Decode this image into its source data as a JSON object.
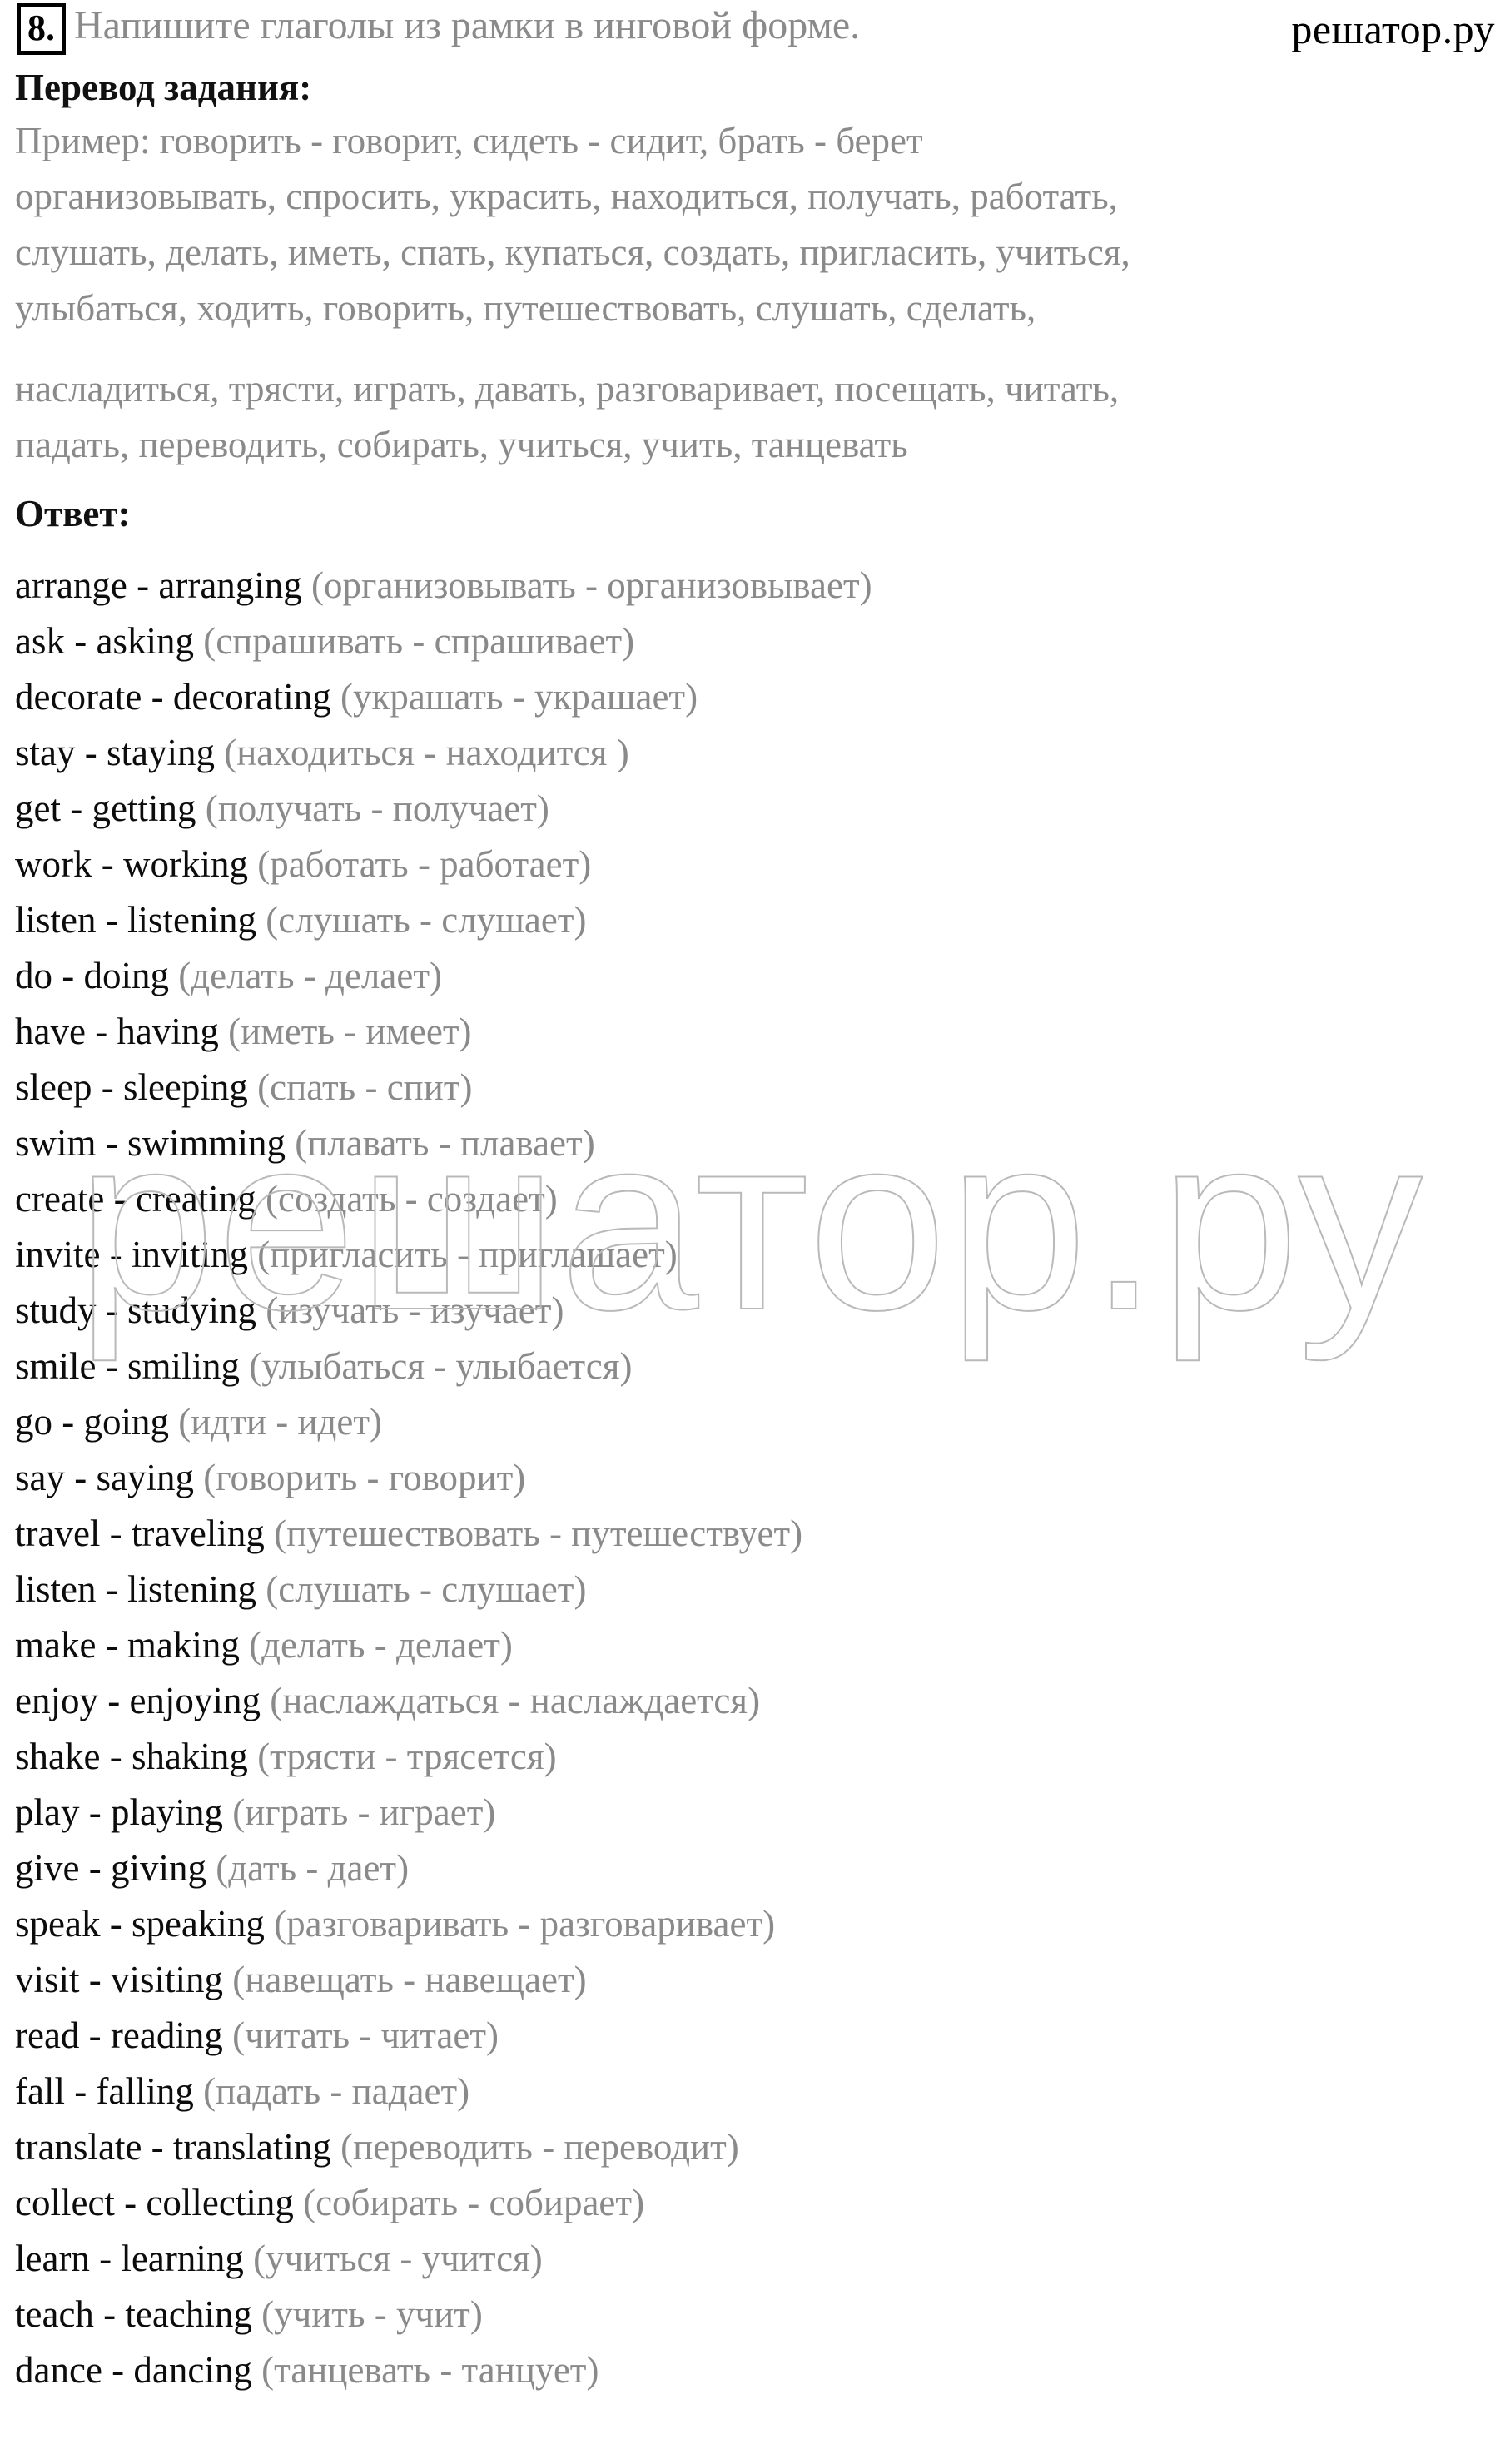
{
  "header": {
    "task_number": "8.",
    "task_title": "Напишите глаголы из рамки в инговой форме.",
    "site_logo": "решатор.ру"
  },
  "watermark": {
    "text": "решатор.ру",
    "color": "#b9b9b9"
  },
  "colors": {
    "english_text": "#0c0c0c",
    "russian_text": "#8a8a8a",
    "heading": "#111111",
    "background": "#ffffff"
  },
  "translation": {
    "heading": "Перевод задания:",
    "lines": [
      "Пример: говорить - говорит, сидеть - сидит, брать - берет",
      "организовывать, спросить, украсить, находиться, получать, работать,",
      "слушать, делать, иметь, спать, купаться, создать, пригласить, учиться,",
      "улыбаться, ходить, говорить, путешествовать, слушать, сделать,",
      "насладиться, трясти, играть, давать, разговаривает, посещать, читать,",
      "падать, переводить, собирать, учиться, учить, танцевать"
    ]
  },
  "answer": {
    "heading": "Ответ:",
    "items": [
      {
        "en": "arrange - arranging ",
        "ru": "(организовывать - организовывает)"
      },
      {
        "en": "ask - asking ",
        "ru": "(спрашивать - спрашивает)"
      },
      {
        "en": "decorate - decorating ",
        "ru": "(украшать - украшает)"
      },
      {
        "en": "stay - staying ",
        "ru": "(находиться - находится )"
      },
      {
        "en": "get - getting ",
        "ru": "(получать - получает)"
      },
      {
        "en": "work - working ",
        "ru": "(работать - работает)"
      },
      {
        "en": "listen - listening ",
        "ru": "(слушать - слушает)"
      },
      {
        "en": "do - doing ",
        "ru": "(делать - делает)"
      },
      {
        "en": "have - having ",
        "ru": "(иметь - имеет)"
      },
      {
        "en": "sleep - sleeping ",
        "ru": "(спать - спит)"
      },
      {
        "en": "swim - swimming ",
        "ru": "(плавать - плавает)"
      },
      {
        "en": "create - creating ",
        "ru": "(создать - создает)"
      },
      {
        "en": "invite - inviting ",
        "ru": "(пригласить - приглашает)"
      },
      {
        "en": "study - studying ",
        "ru": "(изучать - изучает)"
      },
      {
        "en": "smile - smiling ",
        "ru": "(улыбаться - улыбается)"
      },
      {
        "en": "go - going ",
        "ru": "(идти - идет)"
      },
      {
        "en": "say - saying ",
        "ru": "(говорить - говорит)"
      },
      {
        "en": "travel - traveling ",
        "ru": "(путешествовать - путешествует)"
      },
      {
        "en": "listen - listening ",
        "ru": "(слушать - слушает)"
      },
      {
        "en": "make - making ",
        "ru": "(делать - делает)"
      },
      {
        "en": "enjoy - enjoying ",
        "ru": "(наслаждаться - наслаждается)"
      },
      {
        "en": "shake - shaking ",
        "ru": "(трясти - трясется)"
      },
      {
        "en": "play - playing ",
        "ru": "(играть - играет)"
      },
      {
        "en": "give - giving ",
        "ru": "(дать - дает)"
      },
      {
        "en": "speak - speaking ",
        "ru": "(разговаривать - разговаривает)"
      },
      {
        "en": "visit - visiting ",
        "ru": "(навещать - навещает)"
      },
      {
        "en": "read - reading ",
        "ru": "(читать - читает)"
      },
      {
        "en": "fall - falling ",
        "ru": "(падать - падает)"
      },
      {
        "en": "translate - translating ",
        "ru": "(переводить - переводит)"
      },
      {
        "en": "collect - collecting ",
        "ru": "(собирать - собирает)"
      },
      {
        "en": "learn - learning ",
        "ru": "(учиться - учится)"
      },
      {
        "en": "teach - teaching ",
        "ru": "(учить - учит)"
      },
      {
        "en": "dance - dancing ",
        "ru": "(танцевать - танцует)"
      }
    ]
  }
}
